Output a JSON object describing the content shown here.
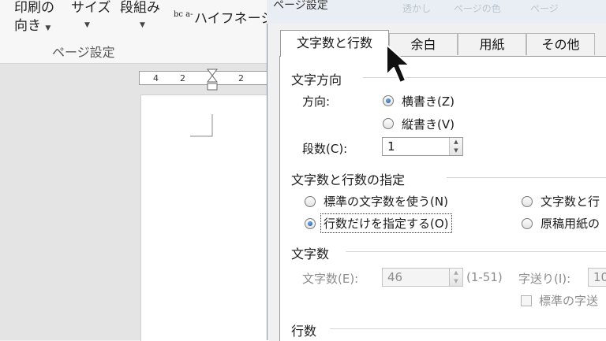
{
  "ribbon": {
    "orientation_line1": "印刷の",
    "orientation_line2": "向き",
    "size_label": "サイズ",
    "columns_label": "段組み",
    "hyphenation_label": "ハイフネーシ",
    "hyphenation_icon": "bc a-",
    "group_label": "ページ設定"
  },
  "ruler": {
    "ticks": [
      "4",
      "2",
      "2"
    ]
  },
  "dialog": {
    "title": "ページ設定",
    "ghost_items": [
      "透かし",
      "ページの色",
      "ページ"
    ],
    "tabs": [
      "文字数と行数",
      "余白",
      "用紙",
      "その他"
    ],
    "active_tab": 0,
    "direction_section": {
      "title": "文字方向",
      "direction_label": "方向:",
      "options": [
        "横書き(Z)",
        "縦書き(V)"
      ],
      "selected": 0,
      "columns_label": "段数(C):",
      "columns_value": "1"
    },
    "grid_section": {
      "title": "文字数と行数の指定",
      "options": [
        "標準の文字数を使う(N)",
        "文字数と行",
        "行数だけを指定する(O)",
        "原稿用紙の"
      ],
      "selected": 2
    },
    "chars_section": {
      "title": "文字数",
      "chars_label": "文字数(E):",
      "chars_value": "46",
      "chars_range": "(1-51)",
      "pitch_label": "字送り(I):",
      "pitch_value": "10",
      "default_pitch_label": "標準の字送"
    },
    "lines_section": {
      "title": "行数"
    }
  },
  "colors": {
    "radio_selected": "#1a55a8",
    "dialog_border": "#7a8fa8"
  },
  "icons": [
    "dropdown-arrow-icon",
    "hyphenation-icon",
    "mouse-pointer-icon",
    "spin-up-icon",
    "spin-down-icon"
  ]
}
